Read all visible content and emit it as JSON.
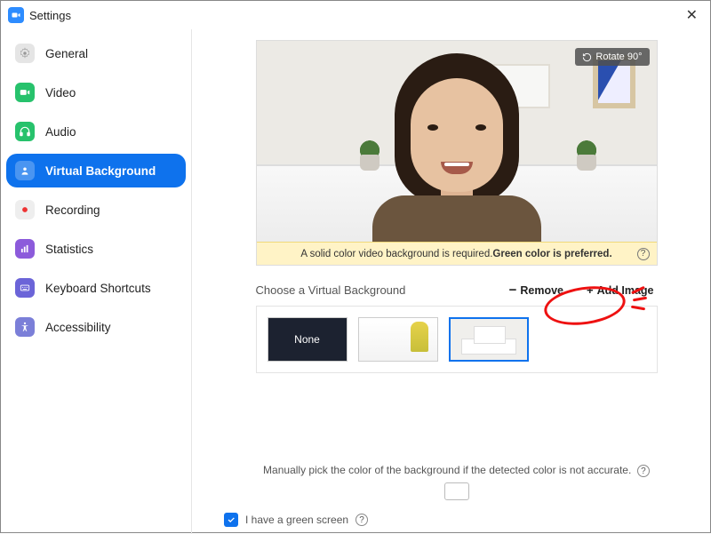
{
  "window": {
    "title": "Settings"
  },
  "sidebar": {
    "items": [
      {
        "label": "General"
      },
      {
        "label": "Video"
      },
      {
        "label": "Audio"
      },
      {
        "label": "Virtual Background"
      },
      {
        "label": "Recording"
      },
      {
        "label": "Statistics"
      },
      {
        "label": "Keyboard Shortcuts"
      },
      {
        "label": "Accessibility"
      }
    ]
  },
  "preview": {
    "rotate_label": "Rotate 90°",
    "banner_prefix": "A solid color video background is required. ",
    "banner_bold": "Green color is preferred."
  },
  "choose": {
    "title": "Choose a Virtual Background",
    "remove": "Remove",
    "add": "Add Image"
  },
  "thumbs": {
    "none": "None"
  },
  "footer": {
    "manual_hint": "Manually pick the color of the background if the detected color is not accurate.",
    "green_screen": "I have a green screen"
  }
}
